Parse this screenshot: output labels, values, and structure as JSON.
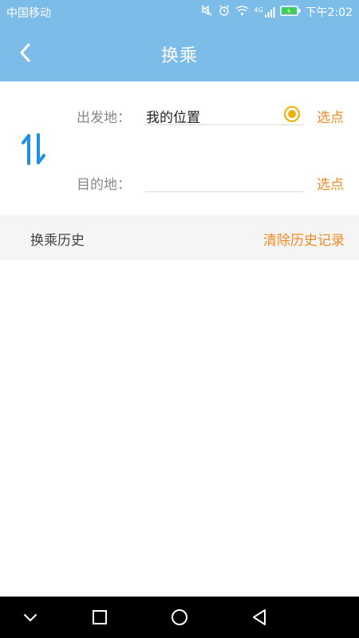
{
  "status_bar": {
    "carrier": "中国移动",
    "network": "4G",
    "time": "下午2:02"
  },
  "header": {
    "title": "换乘",
    "back_icon": "chevron-left-icon"
  },
  "route_form": {
    "origin_label": "出发地：",
    "origin_value": "我的位置",
    "origin_pick": "选点",
    "destination_label": "目的地：",
    "destination_value": "",
    "destination_pick": "选点",
    "swap_icon": "swap-vertical-icon"
  },
  "history": {
    "title": "换乘历史",
    "clear_label": "清除历史记录",
    "items": []
  },
  "nav_bar": {
    "buttons": [
      "chevron-down-icon",
      "square-icon",
      "circle-icon",
      "triangle-back-icon"
    ]
  },
  "colors": {
    "header_bg": "#7cbce9",
    "accent_orange": "#f08a24",
    "swap_blue": "#1e90e6",
    "radio_yellow": "#f0b000",
    "history_bg": "#f5f5f5"
  }
}
